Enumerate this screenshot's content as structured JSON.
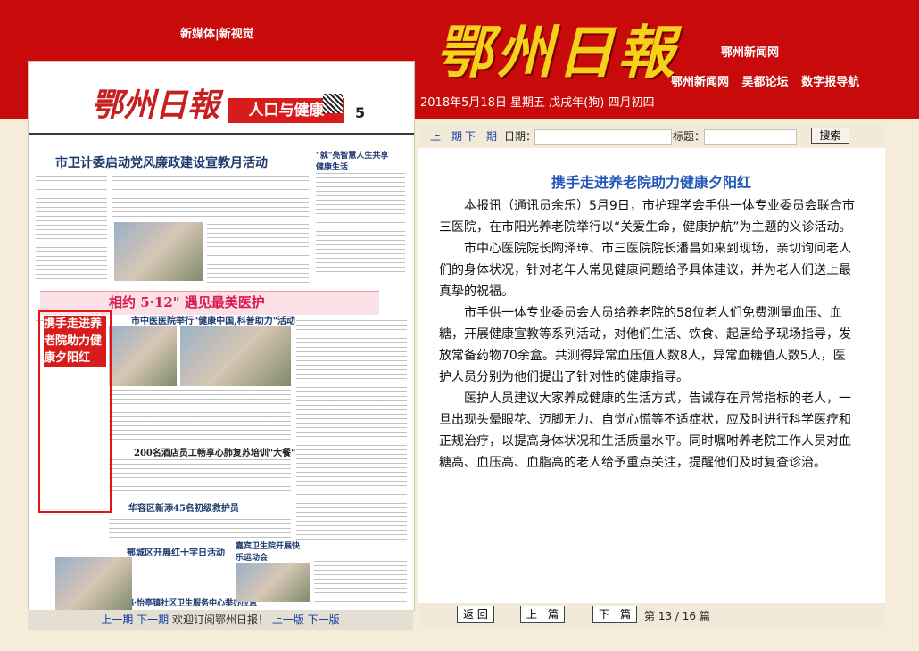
{
  "header": {
    "left_links": "新媒体|新视觉",
    "logo": "鄂州日報",
    "site_name": "鄂州新闻网",
    "nav": [
      "鄂州新闻网",
      "吴都论坛",
      "数字报导航"
    ],
    "date": "2018年5月18日 星期五 戊戌年(狗) 四月初四"
  },
  "paper": {
    "logo": "鄂州日報",
    "section": "人口与健康",
    "page_num": "5",
    "selected_label": "携手走进养老院助力健康夕阳红",
    "headlines": [
      "市卫计委启动党风廉政建设宣教月活动",
      "\"就\"亮智慧人生共享健康生活",
      "相约 5·12\" 遇见最美医护",
      "市中医医院举行\"健康中国,科普助力\"活动",
      "200名酒店员工畅享心肺复苏培训\"大餐\"",
      "华容区新添45名初级救护员",
      "鄂城区开展红十字日活动",
      "飞鹅·怡亭镇社区卫生服务中心举办应急救护技能竞赛",
      "嘉宾卫生院开展快乐运动会"
    ],
    "bottom_nav": {
      "prev_issue": "上一期",
      "next_issue": "下一期",
      "welcome": "欢迎订阅鄂州日报！",
      "prev_page": "上一版",
      "next_page": "下一版"
    }
  },
  "search": {
    "prev_issue": "上一期",
    "next_issue": "下一期",
    "date_label": "日期：",
    "title_label": "标题：",
    "button": "-搜索-"
  },
  "article": {
    "title": "携手走进养老院助力健康夕阳红",
    "paragraphs": [
      "本报讯（通讯员余乐）5月9日，市护理学会手供一体专业委员会联合市三医院，在市阳光养老院举行以“关爱生命，健康护航”为主题的义诊活动。",
      "市中心医院院长陶泽璋、市三医院院长潘昌如来到现场，亲切询问老人们的身体状况，针对老年人常见健康问题给予具体建议，并为老人们送上最真挚的祝福。",
      "市手供一体专业委员会人员给养老院的58位老人们免费测量血压、血糖，开展健康宣教等系列活动，对他们生活、饮食、起居给予现场指导，发放常备药物70余盒。共测得异常血压值人数8人，异常血糖值人数5人，医护人员分别为他们提出了针对性的健康指导。",
      "医护人员建议大家养成健康的生活方式，告诫存在异常指标的老人，一旦出现头晕眼花、迈脚无力、自觉心慌等不适症状，应及时进行科学医疗和正规治疗，以提高身体状况和生活质量水平。同时嘱咐养老院工作人员对血糖高、血压高、血脂高的老人给予重点关注，提醒他们及时复查诊治。"
    ]
  },
  "footer": {
    "back": "返 回",
    "prev": "上一篇",
    "next": "下一篇",
    "count": "第 13 / 16 篇"
  }
}
